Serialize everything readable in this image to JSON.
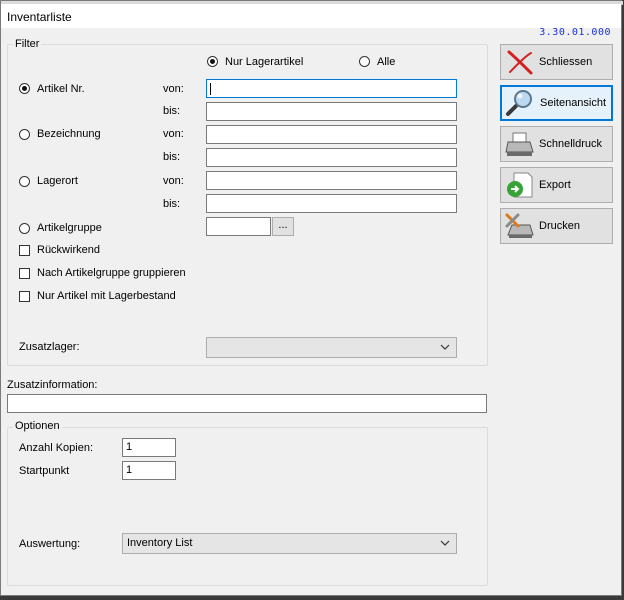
{
  "window": {
    "title": "Inventarliste",
    "version": "3.30.01.000"
  },
  "filter": {
    "legend": "Filter",
    "scope_options": [
      {
        "label": "Nur Lagerartikel",
        "selected": true
      },
      {
        "label": "Alle",
        "selected": false
      }
    ],
    "criteria": {
      "artikel_nr": {
        "label": "Artikel Nr.",
        "selected": true,
        "von_label": "von:",
        "bis_label": "bis:",
        "von_value": "",
        "bis_value": ""
      },
      "bezeichnung": {
        "label": "Bezeichnung",
        "selected": false,
        "von_label": "von:",
        "bis_label": "bis:",
        "von_value": "",
        "bis_value": ""
      },
      "lagerort": {
        "label": "Lagerort",
        "selected": false,
        "von_label": "von:",
        "bis_label": "bis:",
        "von_value": "",
        "bis_value": ""
      },
      "artikelgruppe": {
        "label": "Artikelgruppe",
        "selected": false,
        "value": "",
        "browse_label": "..."
      }
    },
    "checkboxes": [
      {
        "label": "Rückwirkend",
        "checked": false
      },
      {
        "label": "Nach Artikelgruppe gruppieren",
        "checked": false
      },
      {
        "label": "Nur Artikel mit Lagerbestand",
        "checked": false
      }
    ],
    "zusatzlager": {
      "label": "Zusatzlager:",
      "value": ""
    }
  },
  "zusatzinformation": {
    "label": "Zusatzinformation:",
    "value": ""
  },
  "optionen": {
    "legend": "Optionen",
    "anzahl_kopien": {
      "label": "Anzahl Kopien:",
      "value": "1"
    },
    "startpunkt": {
      "label": "Startpunkt",
      "value": "1"
    },
    "auswertung": {
      "label": "Auswertung:",
      "value": "Inventory List"
    }
  },
  "buttons": {
    "schliessen": "Schliessen",
    "seitenansicht": "Seitenansicht",
    "schnelldruck": "Schnelldruck",
    "export": "Export",
    "drucken": "Drucken"
  },
  "colors": {
    "accent": "#0078d7",
    "version_text": "#1a33d6",
    "close_icon": "#d42020"
  }
}
